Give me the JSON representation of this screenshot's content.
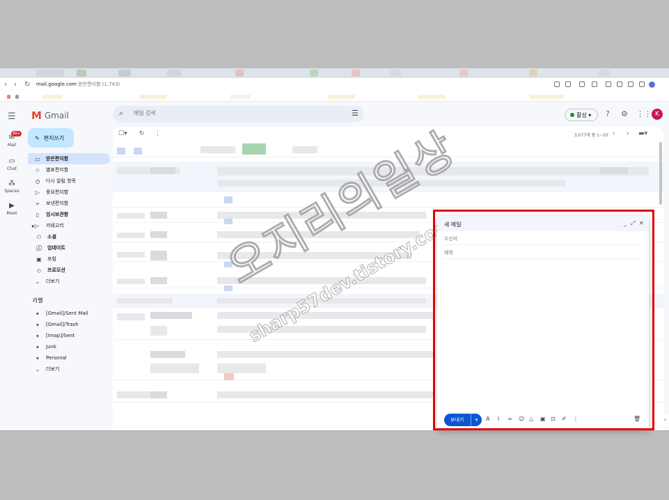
{
  "browser": {
    "url_host": "mail.google.com",
    "url_title": "받은편지함 (1,743)",
    "profile_initial": "K"
  },
  "gmail": {
    "logo_text": "Gmail",
    "search_placeholder": "메일 검색",
    "status_label": "활성",
    "avatar_initial": "K",
    "compose_label": "편지쓰기",
    "rail": [
      {
        "label": "Mail",
        "badge": "99+"
      },
      {
        "label": "Chat"
      },
      {
        "label": "Spaces"
      },
      {
        "label": "Meet"
      }
    ],
    "nav": [
      {
        "label": "받은편지함",
        "icon": "inbox-icon",
        "glyph": "▭"
      },
      {
        "label": "별표편지함",
        "icon": "star-icon",
        "glyph": "☆"
      },
      {
        "label": "다시 알림 항목",
        "icon": "clock-icon",
        "glyph": "◷"
      },
      {
        "label": "중요편지함",
        "icon": "important-icon",
        "glyph": "▷"
      },
      {
        "label": "보낸편지함",
        "icon": "send-icon",
        "glyph": "➢"
      },
      {
        "label": "임시보관함",
        "icon": "draft-icon",
        "glyph": "▯"
      },
      {
        "label": "카테고리",
        "icon": "label-icon",
        "glyph": "▸▷"
      },
      {
        "label": "소셜",
        "icon": "people-icon",
        "glyph": "👥"
      },
      {
        "label": "업데이트",
        "icon": "info-icon",
        "glyph": "ⓘ"
      },
      {
        "label": "포럼",
        "icon": "forum-icon",
        "glyph": "▣"
      },
      {
        "label": "프로모션",
        "icon": "tag-icon",
        "glyph": "◇"
      },
      {
        "label": "더보기",
        "icon": "chevron-down-icon",
        "glyph": "⌄"
      }
    ],
    "labels_title": "라벨",
    "labels": [
      {
        "label": "[Gmail]/Sent Mail"
      },
      {
        "label": "[Gmail]/Trash"
      },
      {
        "label": "[Imap]/Sent"
      },
      {
        "label": "Junk"
      },
      {
        "label": "Personal"
      },
      {
        "label": "더보기"
      }
    ],
    "pagination": "3,077개 중 1~50"
  },
  "compose_window": {
    "title": "새 메일",
    "to_placeholder": "수신자",
    "subject_placeholder": "제목",
    "send_label": "보내기"
  },
  "watermark": {
    "line1": "오지리의일상",
    "line2": "sharp57dev.tistory.com"
  },
  "colors": {
    "highlight": "#e00000",
    "send_button": "#0b57d0",
    "compose_button": "#c2e7ff",
    "active_nav": "#d3e3fd"
  }
}
